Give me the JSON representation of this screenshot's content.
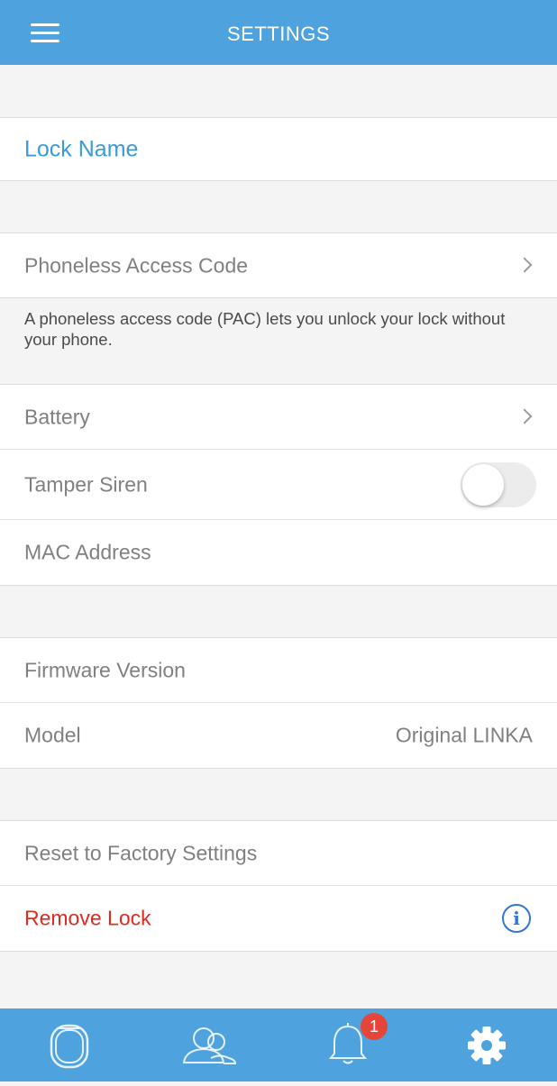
{
  "header": {
    "title": "SETTINGS",
    "menu_icon": "hamburger-menu-icon"
  },
  "lock_name": {
    "label": "Lock Name",
    "color": "#3a9bd8"
  },
  "pac": {
    "label": "Phoneless Access Code",
    "description": "A phoneless access code (PAC) lets you unlock your lock without your phone."
  },
  "battery": {
    "label": "Battery"
  },
  "tamper_siren": {
    "label": "Tamper Siren",
    "enabled": false
  },
  "mac_address": {
    "label": "MAC Address"
  },
  "firmware": {
    "label": "Firmware Version"
  },
  "model": {
    "label": "Model",
    "value": "Original LINKA"
  },
  "reset": {
    "label": "Reset to Factory Settings"
  },
  "remove_lock": {
    "label": "Remove Lock",
    "color": "#e02a1f",
    "info_icon": "info-icon"
  },
  "tabbar": {
    "color": "#4ea3de",
    "tabs": [
      {
        "icon": "lock-icon",
        "active": false
      },
      {
        "icon": "users-icon",
        "active": false
      },
      {
        "icon": "bell-icon",
        "active": false,
        "badge": "1"
      },
      {
        "icon": "gear-icon",
        "active": true
      }
    ]
  }
}
